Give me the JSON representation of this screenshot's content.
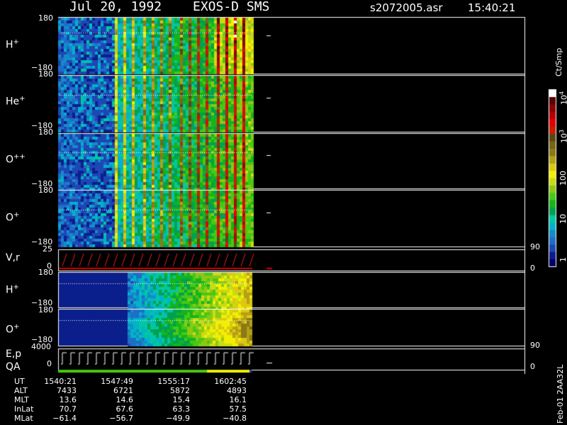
{
  "header": {
    "date": "Jul 20, 1992",
    "instrument": "EXOS-D SMS",
    "file": "s2072005.asr",
    "time": "15:40:21"
  },
  "panels": [
    {
      "label": "H",
      "charge": "+",
      "ymax": "180",
      "ymin": "−180"
    },
    {
      "label": "He",
      "charge": "+",
      "ymax": "180",
      "ymin": "−180"
    },
    {
      "label": "O",
      "charge": "++",
      "ymax": "180",
      "ymin": "−180"
    },
    {
      "label": "O",
      "charge": "+",
      "ymax": "180",
      "ymin": "−180"
    },
    {
      "label": "V,r",
      "charge": "",
      "ymax": "25",
      "ymin": "0",
      "right_top": "90",
      "right_bottom": "0"
    },
    {
      "label": "H",
      "charge": "+",
      "ymax": "180",
      "ymin": "−180"
    },
    {
      "label": "O",
      "charge": "+",
      "ymax": "180",
      "ymin": "−180"
    },
    {
      "label": "E,p",
      "charge": "",
      "ymax": "4000",
      "ymin": "0",
      "right_top": "90",
      "right_bottom": "0"
    }
  ],
  "qa_label": "QA",
  "colorbar": {
    "unit": "Ct/Smp",
    "ticks": [
      "1",
      "10",
      "100",
      "10",
      "10"
    ],
    "tick_exponents": [
      "",
      "",
      "",
      "3",
      "4"
    ],
    "colors": [
      "#000066",
      "#0a1e8c",
      "#1e46b4",
      "#1e6ec8",
      "#148cc8",
      "#00b4c8",
      "#00c8a0",
      "#00a050",
      "#14b41e",
      "#46c814",
      "#8cc814",
      "#c8dc14",
      "#f0f000",
      "#dcc814",
      "#b4a014",
      "#8c7814",
      "#786414",
      "#5a4614",
      "#c81e00",
      "#e60000",
      "#b40000",
      "#8c0000",
      "#5a0000",
      "#ffffff"
    ]
  },
  "footer": {
    "label_row": [
      "UT",
      "ALT",
      "MLT",
      "InLat",
      "MLat"
    ],
    "columns": [
      {
        "UT": "1540:21",
        "ALT": "7433",
        "MLT": "13.6",
        "InLat": "70.7",
        "MLat": "−61.4"
      },
      {
        "UT": "1547:49",
        "ALT": "6721",
        "MLT": "14.6",
        "InLat": "67.6",
        "MLat": "−56.7"
      },
      {
        "UT": "1555:17",
        "ALT": "5872",
        "MLT": "15.4",
        "InLat": "63.3",
        "MLat": "−49.9"
      },
      {
        "UT": "1602:45",
        "ALT": "4893",
        "MLT": "16.1",
        "InLat": "57.5",
        "MLat": "−40.8"
      }
    ],
    "side_note": "Feb-01 2AA32L"
  },
  "chart_data": {
    "type": "heatmap",
    "title": "Jul 20, 1992   EXOS-D SMS",
    "xlabel": "UT",
    "x_ticks": [
      "1540:21",
      "1547:49",
      "1555:17",
      "1602:45"
    ],
    "panels": [
      "H+",
      "He+",
      "O++",
      "O+",
      "V,r",
      "H+",
      "O+",
      "E,p"
    ],
    "y_ranges": [
      [
        -180,
        180
      ],
      [
        -180,
        180
      ],
      [
        -180,
        180
      ],
      [
        -180,
        180
      ],
      [
        0,
        25
      ],
      [
        -180,
        180
      ],
      [
        -180,
        180
      ],
      [
        0,
        4000
      ]
    ],
    "color_scale": "log",
    "color_range": [
      1,
      10000
    ],
    "colorbar_label": "Ct/Smp"
  }
}
